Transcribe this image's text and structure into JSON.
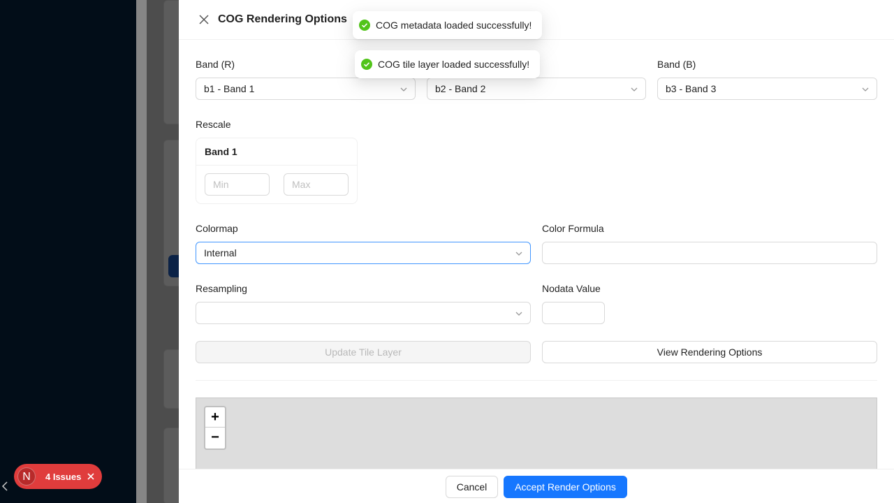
{
  "drawer": {
    "title": "COG Rendering Options"
  },
  "toasts": [
    {
      "text": "COG metadata loaded successfully!"
    },
    {
      "text": "COG tile layer loaded successfully!"
    }
  ],
  "bands": {
    "r_label": "Band (R)",
    "r_value": "b1 - Band 1",
    "g_value": "b2 - Band 2",
    "b_label": "Band (B)",
    "b_value": "b3 - Band 3"
  },
  "rescale": {
    "label": "Rescale",
    "band_title": "Band 1",
    "min_placeholder": "Min",
    "max_placeholder": "Max"
  },
  "colormap": {
    "label": "Colormap",
    "value": "Internal"
  },
  "color_formula": {
    "label": "Color Formula",
    "value": ""
  },
  "resampling": {
    "label": "Resampling",
    "value": ""
  },
  "nodata": {
    "label": "Nodata Value",
    "value": ""
  },
  "actions": {
    "update_label": "Update Tile Layer",
    "view_label": "View Rendering Options"
  },
  "map": {
    "zoom_in": "+",
    "zoom_out": "−"
  },
  "footer": {
    "cancel_label": "Cancel",
    "accept_label": "Accept Render Options"
  },
  "issues": {
    "badge": "N",
    "label": "4 Issues"
  },
  "colors": {
    "primary": "#1677ff",
    "success": "#52c41a",
    "issues_bg": "#e03c3c"
  }
}
